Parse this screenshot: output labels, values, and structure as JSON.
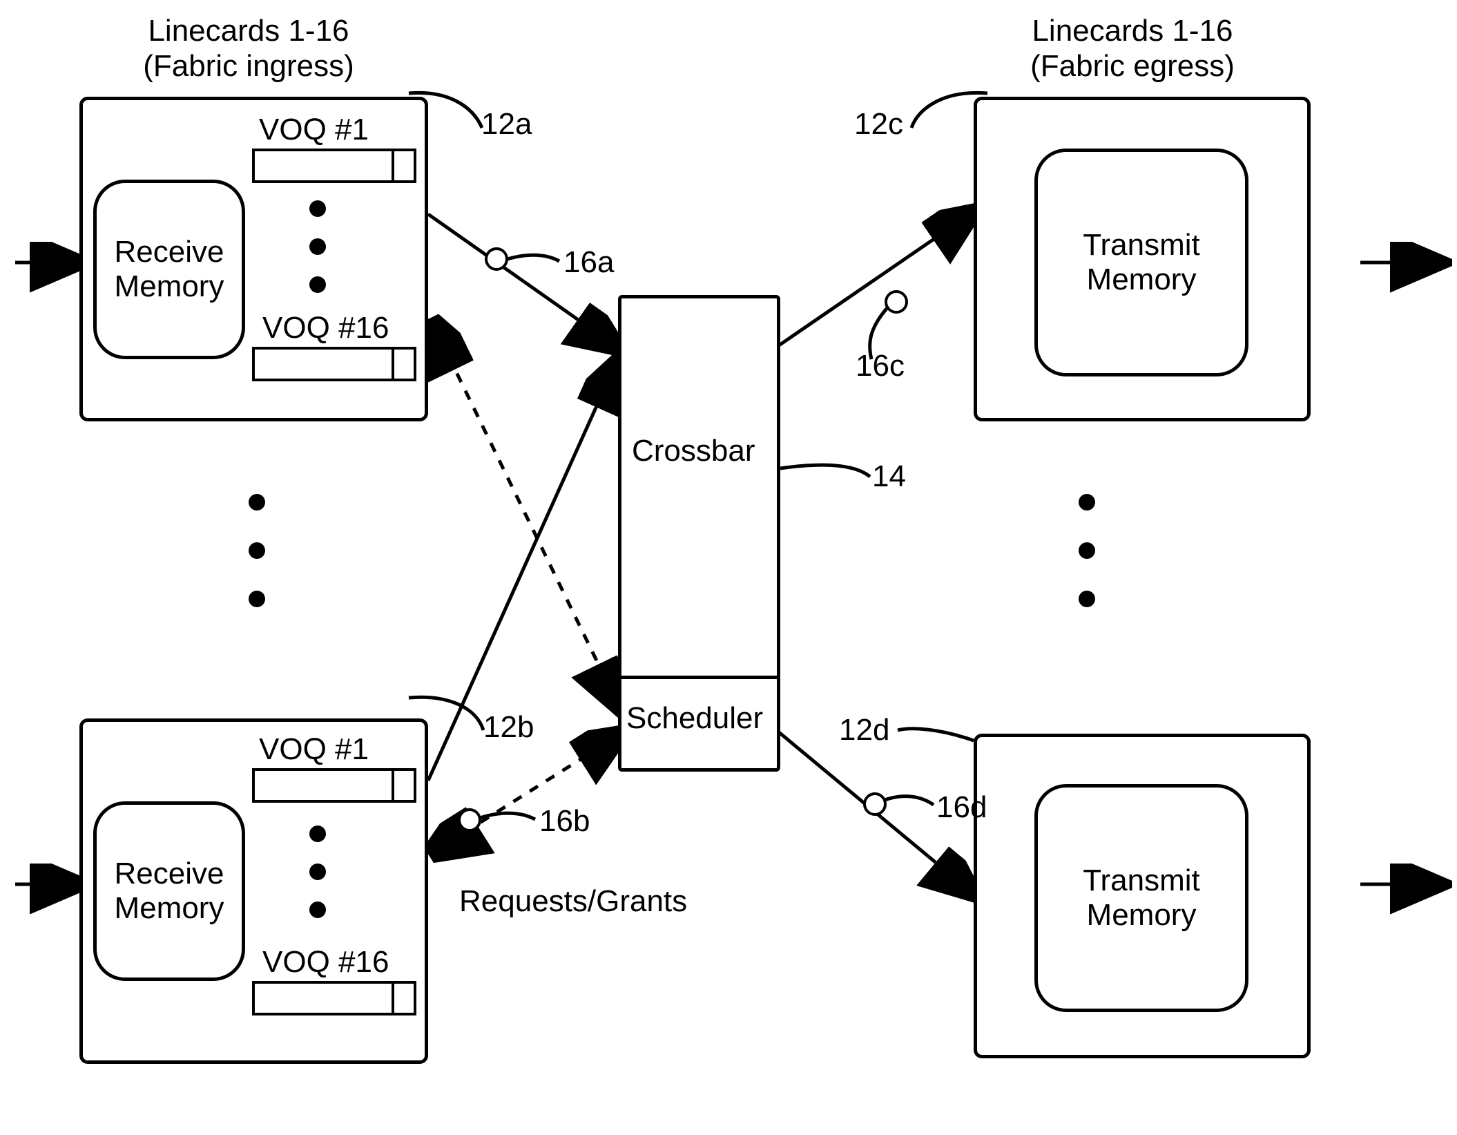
{
  "ingress": {
    "title_line1": "Linecards 1-16",
    "title_line2": "(Fabric ingress)",
    "card_top": {
      "voq_first": "VOQ #1",
      "voq_last": "VOQ #16",
      "mem": "Receive\nMemory",
      "ref": "12a",
      "link_ref": "16a"
    },
    "card_bottom": {
      "voq_first": "VOQ #1",
      "voq_last": "VOQ #16",
      "mem": "Receive\nMemory",
      "ref": "12b",
      "link_ref": "16b"
    }
  },
  "egress": {
    "title_line1": "Linecards 1-16",
    "title_line2": "(Fabric egress)",
    "card_top": {
      "mem": "Transmit\nMemory",
      "ref": "12c",
      "link_ref": "16c"
    },
    "card_bottom": {
      "mem": "Transmit\nMemory",
      "ref": "12d",
      "link_ref": "16d"
    }
  },
  "center": {
    "crossbar": "Crossbar",
    "scheduler": "Scheduler",
    "ref": "14",
    "req_grants": "Requests/Grants"
  }
}
